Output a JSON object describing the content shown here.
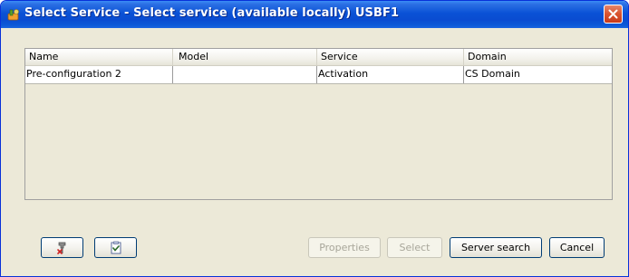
{
  "window": {
    "title": "Select Service - Select service (available locally) USBF1",
    "app_icon": "tool-app-icon",
    "close_icon": "close-icon"
  },
  "table": {
    "columns": [
      "Name",
      "Model",
      "Service",
      "Domain"
    ],
    "rows": [
      [
        "Pre-configuration 2",
        "",
        "Activation",
        "CS Domain"
      ]
    ]
  },
  "toolbar_icons": {
    "first": "wrench-tool-icon",
    "second": "checklist-icon"
  },
  "buttons": {
    "properties": "Properties",
    "select": "Select",
    "server_search": "Server search",
    "cancel": "Cancel"
  },
  "colors": {
    "titlebar": "#0a52d6",
    "close": "#d9532e",
    "dialog_bg": "#ece9d8",
    "disabled_text": "#a8a69a"
  }
}
